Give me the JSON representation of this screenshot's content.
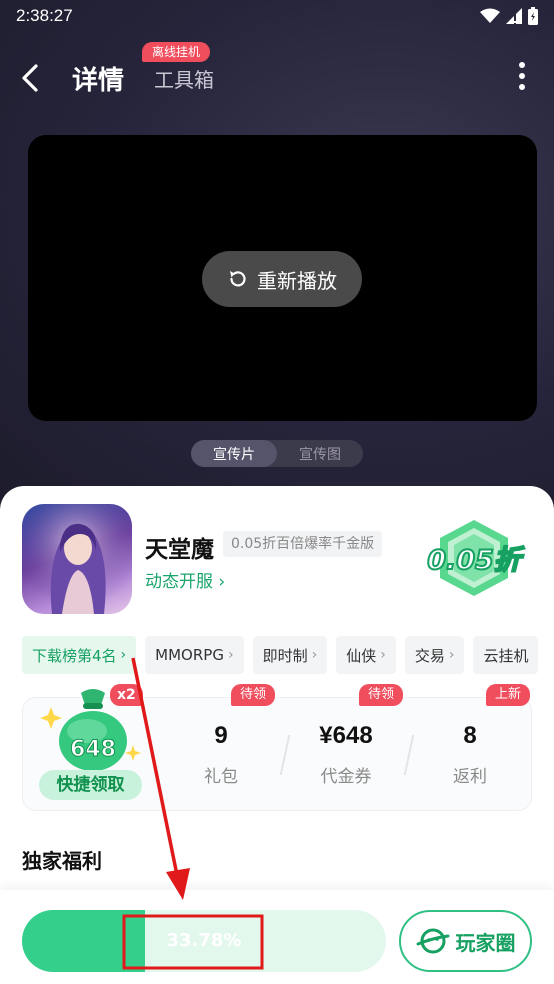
{
  "status_bar": {
    "time": "2:38:27"
  },
  "header": {
    "tab_detail": "详情",
    "tab_tools": "工具箱",
    "offline_badge": "离线挂机"
  },
  "video": {
    "replay_label": "重新播放"
  },
  "media_switch": {
    "options": [
      "宣传片",
      "宣传图"
    ],
    "active_index": 0
  },
  "game": {
    "name": "天堂魔",
    "tagline": "0.05折百倍爆率千金版",
    "server_link": "动态开服",
    "discount_badge": "0.05折"
  },
  "tags": [
    {
      "label": "下载榜第4名",
      "highlight": true
    },
    {
      "label": "MMORPG"
    },
    {
      "label": "即时制"
    },
    {
      "label": "仙侠"
    },
    {
      "label": "交易"
    },
    {
      "label": "云挂机"
    }
  ],
  "benefits": {
    "claim": {
      "badge": "x2",
      "amount": "648",
      "label": "快捷领取"
    },
    "stats": [
      {
        "value": "9",
        "label": "礼包",
        "badge": "待领"
      },
      {
        "value": "¥648",
        "label": "代金券",
        "badge": "待领"
      },
      {
        "value": "8",
        "label": "返利",
        "badge": "上新"
      }
    ]
  },
  "section_title": "独家福利",
  "bottom": {
    "progress": 0.3378,
    "progress_label": "33.78%",
    "player_circle_label": "玩家圈"
  },
  "colors": {
    "accent": "#35cf8c",
    "badge_red": "#f04d5d",
    "annotation_red": "#e01a1a"
  }
}
